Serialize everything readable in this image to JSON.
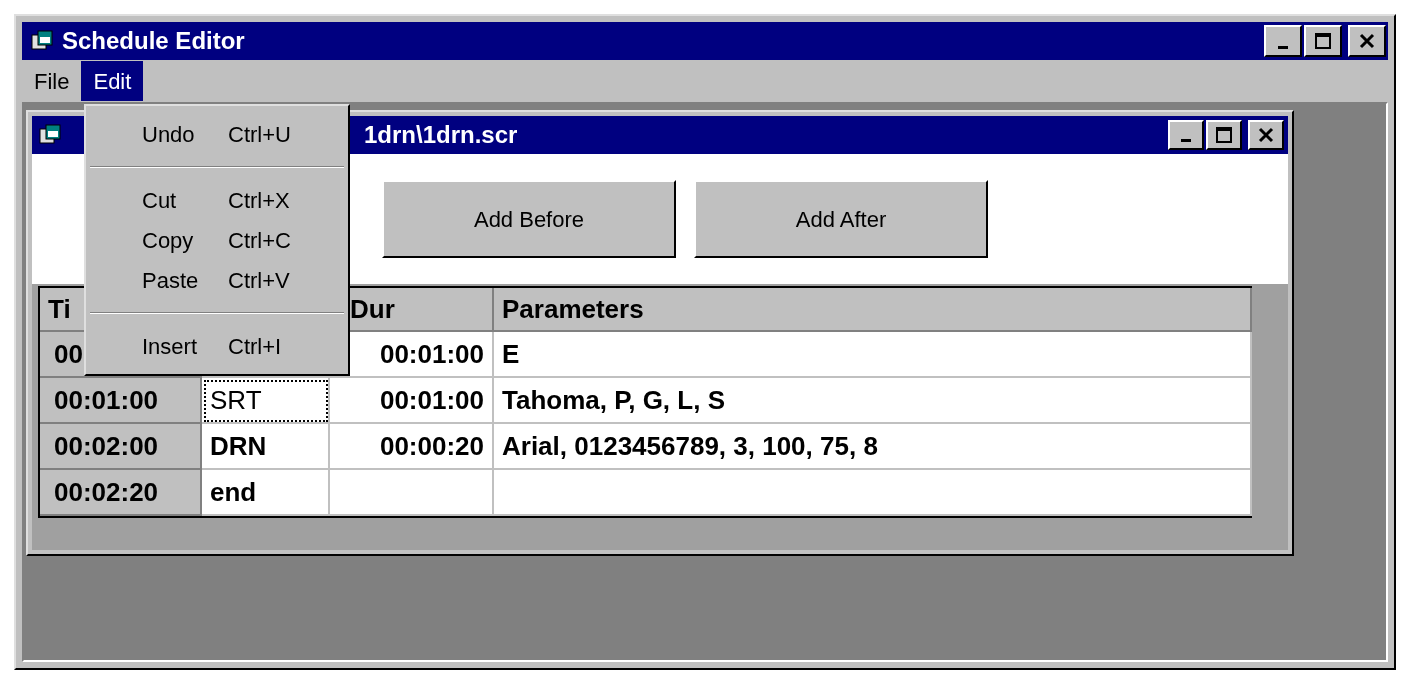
{
  "window": {
    "title": "Schedule Editor"
  },
  "menu_bar": [
    {
      "label": "File",
      "selected": false
    },
    {
      "label": "Edit",
      "selected": true
    }
  ],
  "open_menu": {
    "items": [
      {
        "kind": "item",
        "label": "Undo",
        "shortcut": "Ctrl+U"
      },
      {
        "kind": "separator"
      },
      {
        "kind": "item",
        "label": "Cut",
        "shortcut": "Ctrl+X"
      },
      {
        "kind": "item",
        "label": "Copy",
        "shortcut": "Ctrl+C"
      },
      {
        "kind": "item",
        "label": "Paste",
        "shortcut": "Ctrl+V"
      },
      {
        "kind": "separator"
      },
      {
        "kind": "item",
        "label": "Insert",
        "shortcut": "Ctrl+I"
      }
    ]
  },
  "child_window": {
    "title": "1drn\\1drn.scr",
    "buttons": [
      "Add Before",
      "Add After"
    ],
    "table": {
      "columns": [
        "Ti",
        "",
        "Dur",
        "Parameters"
      ],
      "rows": [
        {
          "cells": [
            {
              "text": "00",
              "selected": false
            },
            {
              "text": ""
            },
            {
              "text": "00:01:00",
              "selected": false
            },
            {
              "text": "E",
              "selected": false
            }
          ]
        },
        {
          "cells": [
            {
              "text": "00:01:00",
              "selected": false
            },
            {
              "text": "SRT",
              "selected": true
            },
            {
              "text": "00:01:00",
              "selected": false
            },
            {
              "text": "Tahoma, P, G, L, S",
              "selected": false
            }
          ]
        },
        {
          "cells": [
            {
              "text": "00:02:00",
              "selected": false
            },
            {
              "text": "DRN",
              "selected": false
            },
            {
              "text": "00:00:20",
              "selected": false
            },
            {
              "text": "Arial, 0123456789, 3, 100, 75, 8",
              "selected": false
            }
          ]
        },
        {
          "cells": [
            {
              "text": "00:02:20",
              "selected": false
            },
            {
              "text": "end",
              "selected": false
            },
            {
              "text": "",
              "selected": false
            },
            {
              "text": "",
              "selected": false
            }
          ]
        }
      ]
    }
  }
}
